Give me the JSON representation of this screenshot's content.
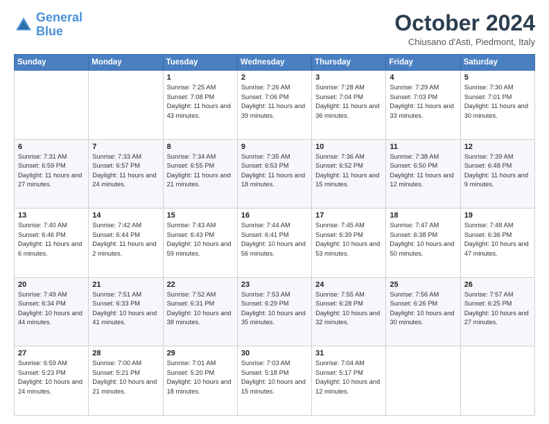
{
  "logo": {
    "line1": "General",
    "line2": "Blue"
  },
  "title": "October 2024",
  "location": "Chiusano d'Asti, Piedmont, Italy",
  "days_of_week": [
    "Sunday",
    "Monday",
    "Tuesday",
    "Wednesday",
    "Thursday",
    "Friday",
    "Saturday"
  ],
  "weeks": [
    [
      {
        "day": "",
        "sunrise": "",
        "sunset": "",
        "daylight": ""
      },
      {
        "day": "",
        "sunrise": "",
        "sunset": "",
        "daylight": ""
      },
      {
        "day": "1",
        "sunrise": "Sunrise: 7:25 AM",
        "sunset": "Sunset: 7:08 PM",
        "daylight": "Daylight: 11 hours and 43 minutes."
      },
      {
        "day": "2",
        "sunrise": "Sunrise: 7:26 AM",
        "sunset": "Sunset: 7:06 PM",
        "daylight": "Daylight: 11 hours and 39 minutes."
      },
      {
        "day": "3",
        "sunrise": "Sunrise: 7:28 AM",
        "sunset": "Sunset: 7:04 PM",
        "daylight": "Daylight: 11 hours and 36 minutes."
      },
      {
        "day": "4",
        "sunrise": "Sunrise: 7:29 AM",
        "sunset": "Sunset: 7:03 PM",
        "daylight": "Daylight: 11 hours and 33 minutes."
      },
      {
        "day": "5",
        "sunrise": "Sunrise: 7:30 AM",
        "sunset": "Sunset: 7:01 PM",
        "daylight": "Daylight: 11 hours and 30 minutes."
      }
    ],
    [
      {
        "day": "6",
        "sunrise": "Sunrise: 7:31 AM",
        "sunset": "Sunset: 6:59 PM",
        "daylight": "Daylight: 11 hours and 27 minutes."
      },
      {
        "day": "7",
        "sunrise": "Sunrise: 7:33 AM",
        "sunset": "Sunset: 6:57 PM",
        "daylight": "Daylight: 11 hours and 24 minutes."
      },
      {
        "day": "8",
        "sunrise": "Sunrise: 7:34 AM",
        "sunset": "Sunset: 6:55 PM",
        "daylight": "Daylight: 11 hours and 21 minutes."
      },
      {
        "day": "9",
        "sunrise": "Sunrise: 7:35 AM",
        "sunset": "Sunset: 6:53 PM",
        "daylight": "Daylight: 11 hours and 18 minutes."
      },
      {
        "day": "10",
        "sunrise": "Sunrise: 7:36 AM",
        "sunset": "Sunset: 6:52 PM",
        "daylight": "Daylight: 11 hours and 15 minutes."
      },
      {
        "day": "11",
        "sunrise": "Sunrise: 7:38 AM",
        "sunset": "Sunset: 6:50 PM",
        "daylight": "Daylight: 11 hours and 12 minutes."
      },
      {
        "day": "12",
        "sunrise": "Sunrise: 7:39 AM",
        "sunset": "Sunset: 6:48 PM",
        "daylight": "Daylight: 11 hours and 9 minutes."
      }
    ],
    [
      {
        "day": "13",
        "sunrise": "Sunrise: 7:40 AM",
        "sunset": "Sunset: 6:46 PM",
        "daylight": "Daylight: 11 hours and 6 minutes."
      },
      {
        "day": "14",
        "sunrise": "Sunrise: 7:42 AM",
        "sunset": "Sunset: 6:44 PM",
        "daylight": "Daylight: 11 hours and 2 minutes."
      },
      {
        "day": "15",
        "sunrise": "Sunrise: 7:43 AM",
        "sunset": "Sunset: 6:43 PM",
        "daylight": "Daylight: 10 hours and 59 minutes."
      },
      {
        "day": "16",
        "sunrise": "Sunrise: 7:44 AM",
        "sunset": "Sunset: 6:41 PM",
        "daylight": "Daylight: 10 hours and 56 minutes."
      },
      {
        "day": "17",
        "sunrise": "Sunrise: 7:45 AM",
        "sunset": "Sunset: 6:39 PM",
        "daylight": "Daylight: 10 hours and 53 minutes."
      },
      {
        "day": "18",
        "sunrise": "Sunrise: 7:47 AM",
        "sunset": "Sunset: 6:38 PM",
        "daylight": "Daylight: 10 hours and 50 minutes."
      },
      {
        "day": "19",
        "sunrise": "Sunrise: 7:48 AM",
        "sunset": "Sunset: 6:36 PM",
        "daylight": "Daylight: 10 hours and 47 minutes."
      }
    ],
    [
      {
        "day": "20",
        "sunrise": "Sunrise: 7:49 AM",
        "sunset": "Sunset: 6:34 PM",
        "daylight": "Daylight: 10 hours and 44 minutes."
      },
      {
        "day": "21",
        "sunrise": "Sunrise: 7:51 AM",
        "sunset": "Sunset: 6:33 PM",
        "daylight": "Daylight: 10 hours and 41 minutes."
      },
      {
        "day": "22",
        "sunrise": "Sunrise: 7:52 AM",
        "sunset": "Sunset: 6:31 PM",
        "daylight": "Daylight: 10 hours and 38 minutes."
      },
      {
        "day": "23",
        "sunrise": "Sunrise: 7:53 AM",
        "sunset": "Sunset: 6:29 PM",
        "daylight": "Daylight: 10 hours and 35 minutes."
      },
      {
        "day": "24",
        "sunrise": "Sunrise: 7:55 AM",
        "sunset": "Sunset: 6:28 PM",
        "daylight": "Daylight: 10 hours and 32 minutes."
      },
      {
        "day": "25",
        "sunrise": "Sunrise: 7:56 AM",
        "sunset": "Sunset: 6:26 PM",
        "daylight": "Daylight: 10 hours and 30 minutes."
      },
      {
        "day": "26",
        "sunrise": "Sunrise: 7:57 AM",
        "sunset": "Sunset: 6:25 PM",
        "daylight": "Daylight: 10 hours and 27 minutes."
      }
    ],
    [
      {
        "day": "27",
        "sunrise": "Sunrise: 6:59 AM",
        "sunset": "Sunset: 5:23 PM",
        "daylight": "Daylight: 10 hours and 24 minutes."
      },
      {
        "day": "28",
        "sunrise": "Sunrise: 7:00 AM",
        "sunset": "Sunset: 5:21 PM",
        "daylight": "Daylight: 10 hours and 21 minutes."
      },
      {
        "day": "29",
        "sunrise": "Sunrise: 7:01 AM",
        "sunset": "Sunset: 5:20 PM",
        "daylight": "Daylight: 10 hours and 18 minutes."
      },
      {
        "day": "30",
        "sunrise": "Sunrise: 7:03 AM",
        "sunset": "Sunset: 5:18 PM",
        "daylight": "Daylight: 10 hours and 15 minutes."
      },
      {
        "day": "31",
        "sunrise": "Sunrise: 7:04 AM",
        "sunset": "Sunset: 5:17 PM",
        "daylight": "Daylight: 10 hours and 12 minutes."
      },
      {
        "day": "",
        "sunrise": "",
        "sunset": "",
        "daylight": ""
      },
      {
        "day": "",
        "sunrise": "",
        "sunset": "",
        "daylight": ""
      }
    ]
  ]
}
